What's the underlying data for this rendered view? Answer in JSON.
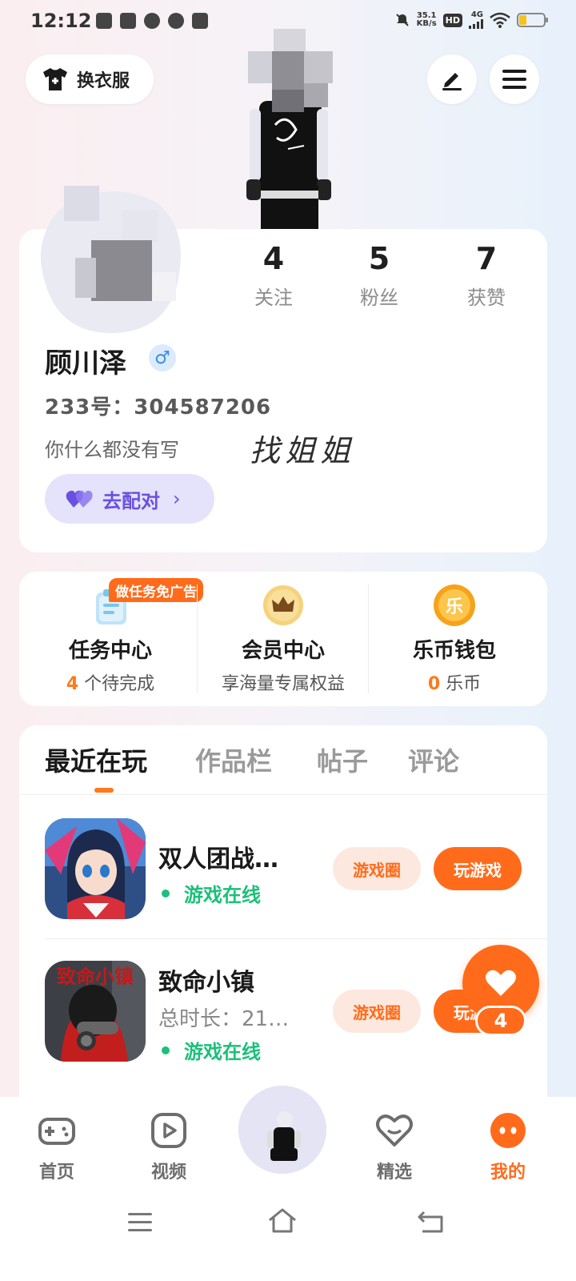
{
  "status_bar": {
    "time": "12:12",
    "net_speed_value": "35.1",
    "net_speed_unit": "KB/s",
    "hd": "HD",
    "network": "4G",
    "battery_level": 0.35
  },
  "header": {
    "dress_button": "换衣服",
    "edit_icon": "pencil-icon",
    "menu_icon": "menu-icon"
  },
  "profile": {
    "stats": [
      {
        "value": "4",
        "label": "关注"
      },
      {
        "value": "5",
        "label": "粉丝"
      },
      {
        "value": "7",
        "label": "获赞"
      }
    ],
    "name": "顾川泽",
    "gender_symbol": "♂",
    "uid": "233号：304587206",
    "bio": "你什么都没有写",
    "handwriting": "找姐姐",
    "match_button": "去配对",
    "match_chevron": "›"
  },
  "entries": {
    "task_badge": "做任务免广告",
    "task": {
      "title": "任务中心",
      "count": "4",
      "suffix": " 个待完成"
    },
    "vip": {
      "title": "会员中心",
      "subtitle": "享海量专属权益"
    },
    "wallet": {
      "title": "乐币钱包",
      "count": "0",
      "suffix": " 乐币",
      "coin_glyph": "乐"
    }
  },
  "tabs": [
    "最近在玩",
    "作品栏",
    "帖子",
    "评论"
  ],
  "games": [
    {
      "name": "双人团战…",
      "status": "游戏在线",
      "circle_btn": "游戏圈",
      "play_btn": "玩游戏"
    },
    {
      "name": "致命小镇",
      "meta": "总时长：21…",
      "status": "游戏在线",
      "circle_btn": "游戏圈",
      "play_btn": "玩游戏",
      "icon_text": "致命小镇"
    }
  ],
  "float_like": {
    "count": "4"
  },
  "bottom_nav": [
    {
      "label": "首页",
      "icon": "gamepad-icon"
    },
    {
      "label": "视频",
      "icon": "video-play-icon"
    },
    {
      "label": "精选",
      "icon": "heart-badge-icon"
    },
    {
      "label": "我的",
      "icon": "smile-face-icon"
    }
  ],
  "colors": {
    "accent": "#ff6b1a",
    "online": "#1cc07a",
    "match": "#6a50e0"
  }
}
